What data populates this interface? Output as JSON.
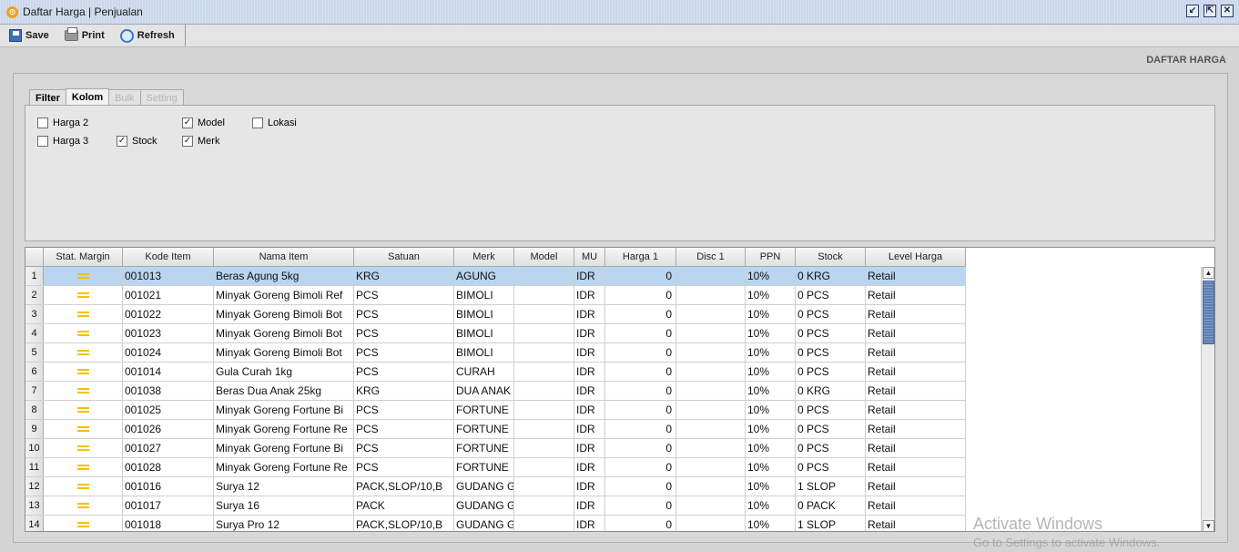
{
  "window": {
    "title": "Daftar Harga | Penjualan"
  },
  "toolbar": {
    "save": "Save",
    "print": "Print",
    "refresh": "Refresh"
  },
  "panel_title": "DAFTAR HARGA",
  "tabs": [
    {
      "label": "Filter",
      "state": "normal"
    },
    {
      "label": "Kolom",
      "state": "active"
    },
    {
      "label": "Bulk",
      "state": "disabled"
    },
    {
      "label": "Setting",
      "state": "disabled"
    }
  ],
  "columns_options": [
    {
      "label": "Harga 2",
      "checked": false
    },
    {
      "label": "Harga 3",
      "checked": false
    },
    {
      "label": "Stock",
      "checked": true
    },
    {
      "label": "Model",
      "checked": true
    },
    {
      "label": "Merk",
      "checked": true
    },
    {
      "label": "Lokasi",
      "checked": false
    }
  ],
  "grid": {
    "headers": [
      "Stat. Margin",
      "Kode Item",
      "Nama Item",
      "Satuan",
      "Merk",
      "Model",
      "MU",
      "Harga 1",
      "Disc 1",
      "PPN",
      "Stock",
      "Level Harga"
    ],
    "rows": [
      {
        "no": "1",
        "kode": "001013",
        "nama": "Beras Agung 5kg",
        "satuan": "KRG",
        "merk": "AGUNG",
        "model": "",
        "mu": "IDR",
        "harga1": "0",
        "disc1": "",
        "ppn": "10%",
        "stock": "0 KRG",
        "level": "Retail"
      },
      {
        "no": "2",
        "kode": "001021",
        "nama": "Minyak Goreng Bimoli Ref",
        "satuan": "PCS",
        "merk": "BIMOLI",
        "model": "",
        "mu": "IDR",
        "harga1": "0",
        "disc1": "",
        "ppn": "10%",
        "stock": "0 PCS",
        "level": "Retail"
      },
      {
        "no": "3",
        "kode": "001022",
        "nama": "Minyak Goreng Bimoli Bot",
        "satuan": "PCS",
        "merk": "BIMOLI",
        "model": "",
        "mu": "IDR",
        "harga1": "0",
        "disc1": "",
        "ppn": "10%",
        "stock": "0 PCS",
        "level": "Retail"
      },
      {
        "no": "4",
        "kode": "001023",
        "nama": "Minyak Goreng Bimoli Bot",
        "satuan": "PCS",
        "merk": "BIMOLI",
        "model": "",
        "mu": "IDR",
        "harga1": "0",
        "disc1": "",
        "ppn": "10%",
        "stock": "0 PCS",
        "level": "Retail"
      },
      {
        "no": "5",
        "kode": "001024",
        "nama": "Minyak Goreng Bimoli Bot",
        "satuan": "PCS",
        "merk": "BIMOLI",
        "model": "",
        "mu": "IDR",
        "harga1": "0",
        "disc1": "",
        "ppn": "10%",
        "stock": "0 PCS",
        "level": "Retail"
      },
      {
        "no": "6",
        "kode": "001014",
        "nama": "Gula Curah 1kg",
        "satuan": "PCS",
        "merk": "CURAH",
        "model": "",
        "mu": "IDR",
        "harga1": "0",
        "disc1": "",
        "ppn": "10%",
        "stock": "0 PCS",
        "level": "Retail"
      },
      {
        "no": "7",
        "kode": "001038",
        "nama": "Beras Dua Anak 25kg",
        "satuan": "KRG",
        "merk": "DUA ANAK",
        "model": "",
        "mu": "IDR",
        "harga1": "0",
        "disc1": "",
        "ppn": "10%",
        "stock": "0 KRG",
        "level": "Retail"
      },
      {
        "no": "8",
        "kode": "001025",
        "nama": "Minyak Goreng Fortune Bi",
        "satuan": "PCS",
        "merk": "FORTUNE",
        "model": "",
        "mu": "IDR",
        "harga1": "0",
        "disc1": "",
        "ppn": "10%",
        "stock": "0 PCS",
        "level": "Retail"
      },
      {
        "no": "9",
        "kode": "001026",
        "nama": "Minyak Goreng Fortune Re",
        "satuan": "PCS",
        "merk": "FORTUNE",
        "model": "",
        "mu": "IDR",
        "harga1": "0",
        "disc1": "",
        "ppn": "10%",
        "stock": "0 PCS",
        "level": "Retail"
      },
      {
        "no": "10",
        "kode": "001027",
        "nama": "Minyak Goreng Fortune Bi",
        "satuan": "PCS",
        "merk": "FORTUNE",
        "model": "",
        "mu": "IDR",
        "harga1": "0",
        "disc1": "",
        "ppn": "10%",
        "stock": "0 PCS",
        "level": "Retail"
      },
      {
        "no": "11",
        "kode": "001028",
        "nama": "Minyak Goreng Fortune Re",
        "satuan": "PCS",
        "merk": "FORTUNE",
        "model": "",
        "mu": "IDR",
        "harga1": "0",
        "disc1": "",
        "ppn": "10%",
        "stock": "0 PCS",
        "level": "Retail"
      },
      {
        "no": "12",
        "kode": "001016",
        "nama": "Surya 12",
        "satuan": "PACK,SLOP/10,B",
        "merk": "GUDANG G",
        "model": "",
        "mu": "IDR",
        "harga1": "0",
        "disc1": "",
        "ppn": "10%",
        "stock": "1 SLOP",
        "level": "Retail"
      },
      {
        "no": "13",
        "kode": "001017",
        "nama": "Surya 16",
        "satuan": "PACK",
        "merk": "GUDANG G",
        "model": "",
        "mu": "IDR",
        "harga1": "0",
        "disc1": "",
        "ppn": "10%",
        "stock": "0 PACK",
        "level": "Retail"
      },
      {
        "no": "14",
        "kode": "001018",
        "nama": "Surya Pro 12",
        "satuan": "PACK,SLOP/10,B",
        "merk": "GUDANG G",
        "model": "",
        "mu": "IDR",
        "harga1": "0",
        "disc1": "",
        "ppn": "10%",
        "stock": "1 SLOP",
        "level": "Retail"
      }
    ],
    "selected_row": 0
  },
  "watermark": {
    "line1": "Activate Windows",
    "line2": "Go to Settings to activate Windows."
  }
}
